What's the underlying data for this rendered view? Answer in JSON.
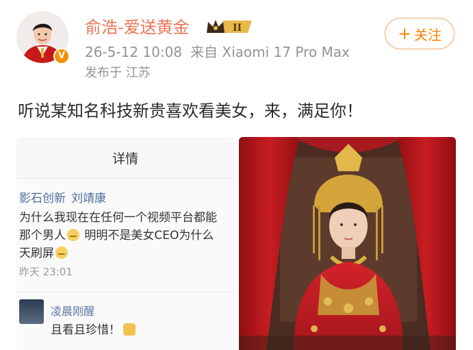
{
  "post": {
    "author": "俞浩-爱送黄金",
    "badge_level": "II",
    "date": "26-5-12 10:08",
    "source": "来自 Xiaomi 17 Pro Max",
    "location": "发布于 江苏",
    "follow_label": "关注",
    "follow_plus": "+",
    "verified_mark": "V",
    "text": "听说某知名科技新贵喜欢看美女，来，满足你！"
  },
  "screenshot": {
    "header": "详情",
    "author_org": "影石创新",
    "author_name": "刘靖康",
    "line1": "为什么我现在在任何一个视频平台都能",
    "line2_a": "那个男人",
    "line2_b": " 明明不是美女CEO为什么",
    "line3": "天刷屏",
    "time": "昨天 23:01",
    "comment_author": "凌晨刚醒",
    "comment_text": "且看且珍惜！"
  },
  "colors": {
    "username": "#eb7350",
    "follow": "#ff8200",
    "link_blue": "#506f9f",
    "verified": "#f29100"
  },
  "icons": {
    "verified": "verified-v-icon",
    "crown": "crown-badge-icon",
    "follow": "plus-icon"
  }
}
